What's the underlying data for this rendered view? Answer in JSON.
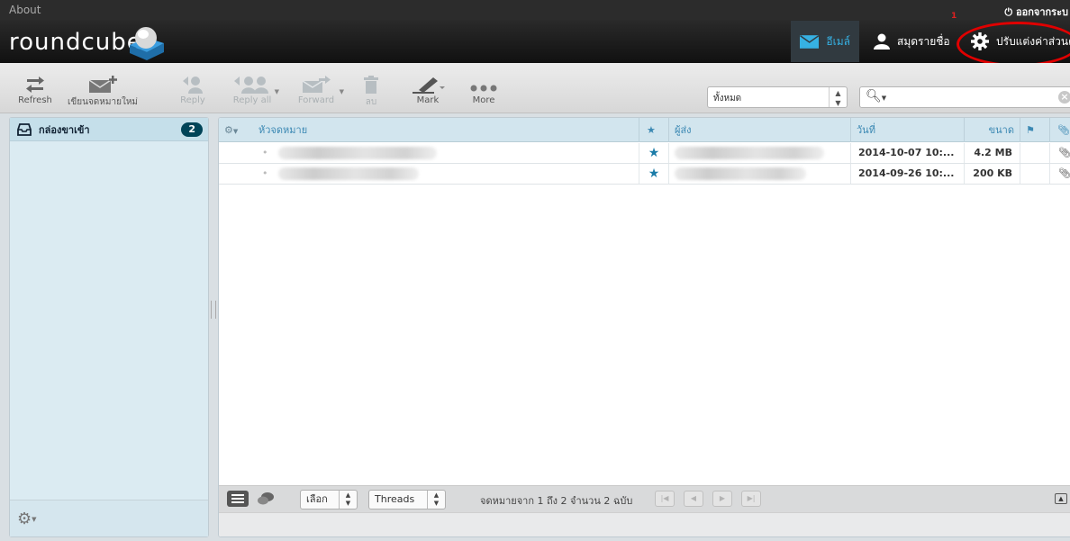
{
  "topbar": {
    "about": "About",
    "logout": "ออกจากระบ"
  },
  "header": {
    "logo": "roundcube",
    "nav": [
      {
        "label": "อีเมล์",
        "icon": "envelope-icon"
      },
      {
        "label": "สมุดรายชื่อ",
        "icon": "user-icon"
      },
      {
        "label": "ปรับแต่งค่าส่วนตั",
        "icon": "gear-icon"
      }
    ],
    "annotation_number": "1"
  },
  "toolbar": {
    "refresh": "Refresh",
    "compose": "เขียนจดหมายใหม่",
    "reply": "Reply",
    "reply_all": "Reply all",
    "forward": "Forward",
    "delete": "ลบ",
    "mark": "Mark",
    "more": "More",
    "filter_value": "ทั้งหมด",
    "search_placeholder": ""
  },
  "folders": {
    "items": [
      {
        "label": "กล่องขาเข้า",
        "unread": "2"
      }
    ]
  },
  "list": {
    "headers": {
      "subject": "หัวจดหมาย",
      "from": "ผู้ส่ง",
      "date": "วันที่",
      "size": "ขนาด"
    },
    "rows": [
      {
        "date": "2014-10-07 10:...",
        "size": "4.2 MB"
      },
      {
        "date": "2014-09-26 10:...",
        "size": "200 KB"
      }
    ],
    "footer": {
      "select": "เลือก",
      "threads": "Threads",
      "count": "จดหมายจาก 1 ถึง 2 จำนวน 2 ฉบับ"
    }
  },
  "colors": {
    "accent": "#36b1e3",
    "badge": "#004458",
    "star": "#1b7ca8",
    "annotation": "#e00000"
  }
}
